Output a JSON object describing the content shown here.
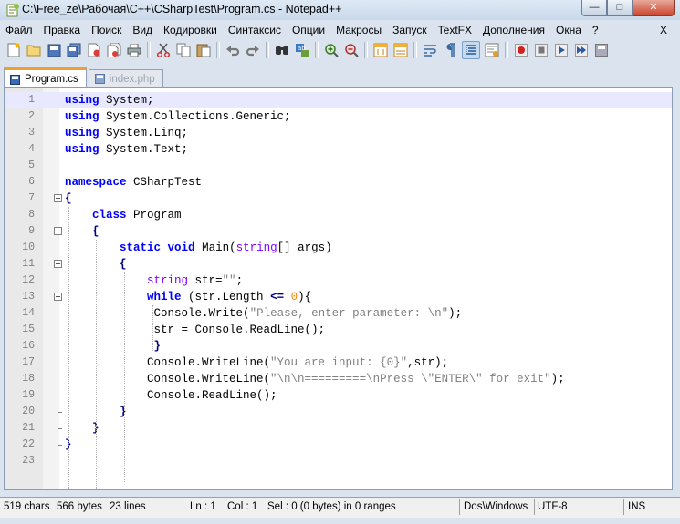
{
  "window": {
    "title": "C:\\Free_ze\\Рабочая\\C++\\CSharpTest\\Program.cs - Notepad++",
    "minimize": "—",
    "maximize": "□",
    "close": "✕"
  },
  "menu": {
    "items": [
      "Файл",
      "Правка",
      "Поиск",
      "Вид",
      "Кодировки",
      "Синтаксис",
      "Опции",
      "Макросы",
      "Запуск",
      "TextFX",
      "Дополнения",
      "Окна",
      "?"
    ],
    "close": "X"
  },
  "toolbar": {
    "icons": [
      "new-file-icon",
      "open-file-icon",
      "save-icon",
      "save-all-icon",
      "close-icon",
      "close-all-icon",
      "print-icon",
      "cut-icon",
      "copy-icon",
      "paste-icon",
      "undo-icon",
      "redo-icon",
      "find-icon",
      "replace-icon",
      "zoom-in-icon",
      "zoom-out-icon",
      "sync-vertical-icon",
      "sync-horizontal-icon",
      "word-wrap-icon",
      "show-all-chars-icon",
      "indent-guide-icon",
      "user-language-icon",
      "record-macro-icon",
      "stop-macro-icon",
      "play-macro-icon",
      "run-macro-multiple-icon",
      "save-macro-icon"
    ]
  },
  "tabs": [
    {
      "label": "Program.cs",
      "active": true
    },
    {
      "label": "index.php",
      "active": false
    }
  ],
  "editor": {
    "line_numbers": [
      "1",
      "2",
      "3",
      "4",
      "5",
      "6",
      "7",
      "8",
      "9",
      "10",
      "11",
      "12",
      "13",
      "14",
      "15",
      "16",
      "17",
      "18",
      "19",
      "20",
      "21",
      "22",
      "23"
    ],
    "tokens": {
      "using": "using",
      "system": " System;",
      "collections": " System.Collections.Generic;",
      "linq": " System.Linq;",
      "text": " System.Text;",
      "namespace": "namespace",
      "ns_name": " CSharpTest",
      "open_brace": "{",
      "close_brace": "}",
      "class": "class",
      "class_name": " Program",
      "static": "static",
      "void": "void",
      "main": " Main(",
      "string": "string",
      "args": "[] args)",
      "str_decl": " str=",
      "empty_str": "\"\"",
      "semicolon": ";",
      "while": "while",
      "cond_a": " (str.Length ",
      "lte": "<=",
      "zero": "0",
      "cond_b": "){",
      "write_a": "Console.Write(",
      "please": "\"Please, enter parameter: \\n\"",
      "close_stmt": ");",
      "readline_a": "str = Console.ReadLine();",
      "writeline_a": "Console.WriteLine(",
      "you_are": "\"You are input: {0}\"",
      "wl_end": ",str);",
      "press": "\"\\n\\n=========\\nPress \\\"ENTER\\\" for exit\"",
      "readline_b": "Console.ReadLine();"
    }
  },
  "status": {
    "chars": "519 chars",
    "bytes": "566 bytes",
    "lines": "23 lines",
    "ln": "Ln : 1",
    "col": "Col : 1",
    "sel": "Sel : 0 (0 bytes) in 0 ranges",
    "eol": "Dos\\Windows",
    "encoding": "UTF-8",
    "mode": "INS"
  }
}
